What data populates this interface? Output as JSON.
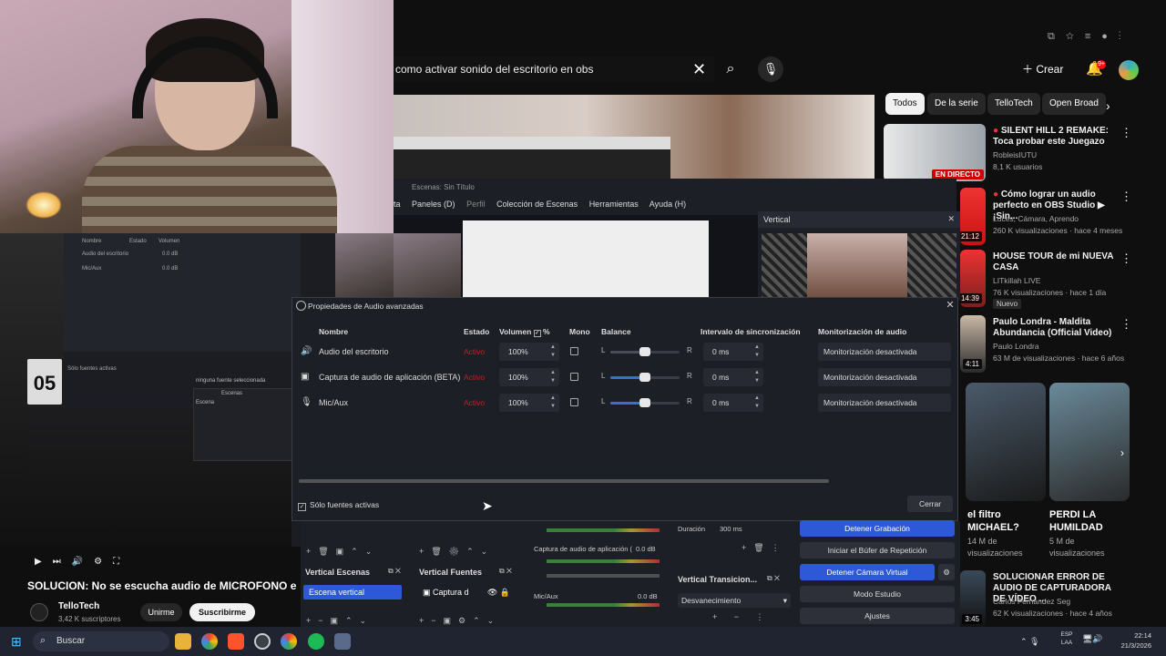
{
  "youtube": {
    "search_query": "como activar sonido del escritorio en obs",
    "create_label": "Crear",
    "notification_count": "9+",
    "chips": [
      "Todos",
      "De la serie",
      "TelloTech",
      "Open Broad"
    ],
    "recommendations": [
      {
        "title": "SILENT HILL 2 REMAKE: Toca probar este Juegazo",
        "channel": "RobleisIUTU",
        "meta": "8,1 K usuarios",
        "badge": "EN DIRECTO",
        "duration": ""
      },
      {
        "title": "Cómo lograr un audio perfecto en OBS Studio ▶ ¡Sin...",
        "channel": "Luces, Cámara, Aprendo",
        "meta": "260 K visualizaciones · hace 4 meses",
        "badge": "",
        "duration": "21:12"
      },
      {
        "title": "HOUSE TOUR de mi NUEVA CASA",
        "channel": "LITkillah LIVE",
        "meta": "76 K visualizaciones · hace 1 día",
        "badge": "Nuevo",
        "duration": "14:39"
      },
      {
        "title": "Paulo Londra - Maldita Abundancia (Official Video)",
        "channel": "Paulo Londra",
        "meta": "63 M de visualizaciones · hace 6 años",
        "badge": "",
        "duration": "4:11"
      },
      {
        "title": "SOLUCIONAR ERROR DE AUDIO DE CAPTURADORA DE VÍDEO ...",
        "channel": "Carlos Fernandez Seg",
        "meta": "62 K visualizaciones · hace 4 años",
        "badge": "",
        "duration": "3:45"
      }
    ],
    "shorts": [
      {
        "title": "el filtro MICHAEL?",
        "meta": "14 M de visualizaciones"
      },
      {
        "title": "PERDI LA HUMILDAD",
        "meta": "5 M de visualizaciones"
      }
    ],
    "video_title": "SOLUCION: No se escucha audio de MICROFONO e",
    "channel_name": "TelloTech",
    "channel_subs": "3,42 K suscriptores",
    "join_label": "Unirme",
    "subscribe_label": "Suscribirme"
  },
  "obs": {
    "window_title": "Propiedades de Audio avanzadas",
    "scenes_title": "Escenas: Sin Título",
    "menu": [
      "ta",
      "Paneles (D)",
      "Perfil",
      "Colección de Escenas",
      "Herramientas",
      "Ayuda (H)"
    ],
    "vertical_dock_title": "Vertical",
    "columns": {
      "name": "Nombre",
      "state": "Estado",
      "volume": "Volumen",
      "percent": "%",
      "mono": "Mono",
      "balance": "Balance",
      "sync": "Intervalo de sincronización",
      "monitor": "Monitorización de audio"
    },
    "rows": [
      {
        "name": "Audio del escritorio",
        "state": "Activo",
        "volume": "100%",
        "balance_left": "L",
        "balance_right": "R",
        "balance": 0.5,
        "sync": "0 ms",
        "monitor": "Monitorización desactivada",
        "icon": "speaker-icon"
      },
      {
        "name": "Captura de audio de aplicación (BETA)",
        "state": "Activo",
        "volume": "100%",
        "balance_left": "L",
        "balance_right": "R",
        "balance": 0.5,
        "sync": "0 ms",
        "monitor": "Monitorización desactivada",
        "icon": "app-capture-icon"
      },
      {
        "name": "Mic/Aux",
        "state": "Activo",
        "volume": "100%",
        "balance_left": "L",
        "balance_right": "R",
        "balance": 0.5,
        "sync": "0 ms",
        "monitor": "Monitorización desactivada",
        "icon": "microphone-icon"
      }
    ],
    "active_only_label": "Sólo fuentes activas",
    "close_label": "Cerrar",
    "docks": {
      "vertical_scenes": "Vertical Escenas",
      "vertical_scene_item": "Escena vertical",
      "vertical_sources": "Vertical Fuentes",
      "vertical_source_item": "Captura d",
      "vertical_transitions": "Vertical Transicion...",
      "transition_type": "Desvanecimiento",
      "duration_label": "Duración",
      "duration_value": "300 ms",
      "app_capture_label": "Captura de audio de aplicación (",
      "app_capture_db": "0.0 dB",
      "mic_label": "Mic/Aux",
      "mic_db": "0.0 dB",
      "controls": [
        "Detener Grabación",
        "Iniciar el Búfer de Repetición",
        "Detener Cámara Virtual",
        "Modo Estudio",
        "Ajustes"
      ]
    }
  },
  "left_obs": {
    "mixer_cols": [
      "Nombre",
      "Estado",
      "Volumen"
    ],
    "mixer_rows": [
      {
        "name": "Audio del escritorio",
        "value": "0.0 dB"
      },
      {
        "name": "Mic/Aux",
        "value": "0.0 dB"
      }
    ],
    "active_only": "Sólo fuentes activas",
    "scene_note": "ninguna fuente seleccionada",
    "scenes_header": "Escenas",
    "scene_item": "Escena",
    "plate": "05"
  },
  "taskbar": {
    "search_placeholder": "Buscar",
    "lang_top": "ESP",
    "lang_bottom": "LAA",
    "time": "22:14",
    "date": "21/3/2026"
  },
  "colors": {
    "accent": "#2d59d8",
    "youtube_red": "#cc0000",
    "status_red": "#b22222"
  }
}
